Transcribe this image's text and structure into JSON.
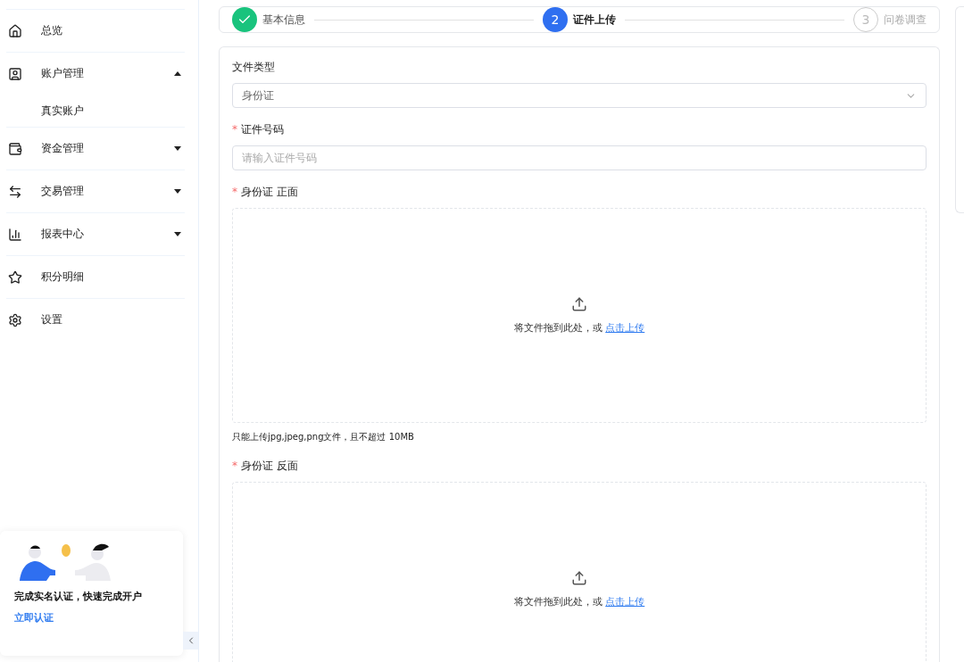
{
  "sidebar": {
    "items": [
      {
        "label": "总览"
      },
      {
        "label": "账户管理",
        "expanded": true,
        "children": [
          {
            "label": "真实账户"
          }
        ]
      },
      {
        "label": "资金管理",
        "expanded": false
      },
      {
        "label": "交易管理",
        "expanded": false
      },
      {
        "label": "报表中心",
        "expanded": false
      },
      {
        "label": "积分明细"
      },
      {
        "label": "设置"
      }
    ],
    "promo": {
      "title": "完成实名认证，快速完成开户",
      "link": "立即认证"
    }
  },
  "steps": [
    {
      "label": "基本信息",
      "done": true,
      "selected": false
    },
    {
      "number": "2",
      "label": "证件上传",
      "done": false,
      "selected": true
    },
    {
      "number": "3",
      "label": "问卷调查",
      "done": false,
      "selected": false
    }
  ],
  "form": {
    "fields": [
      {
        "kind": "select",
        "label": "文件类型",
        "value": "身份证"
      },
      {
        "kind": "input",
        "required_mark": "*",
        "label": "证件号码",
        "placeholder": "请输入证件号码"
      },
      {
        "kind": "upload",
        "required_mark": "*",
        "label": "身份证 正面",
        "text": "将文件拖到此处，或",
        "link": "点击上传",
        "hint": "只能上传jpg,jpeg,png文件，且不超过 10MB"
      },
      {
        "kind": "upload",
        "required_mark": "*",
        "label": "身份证 反面",
        "text": "将文件拖到此处，或",
        "link": "点击上传"
      }
    ]
  }
}
